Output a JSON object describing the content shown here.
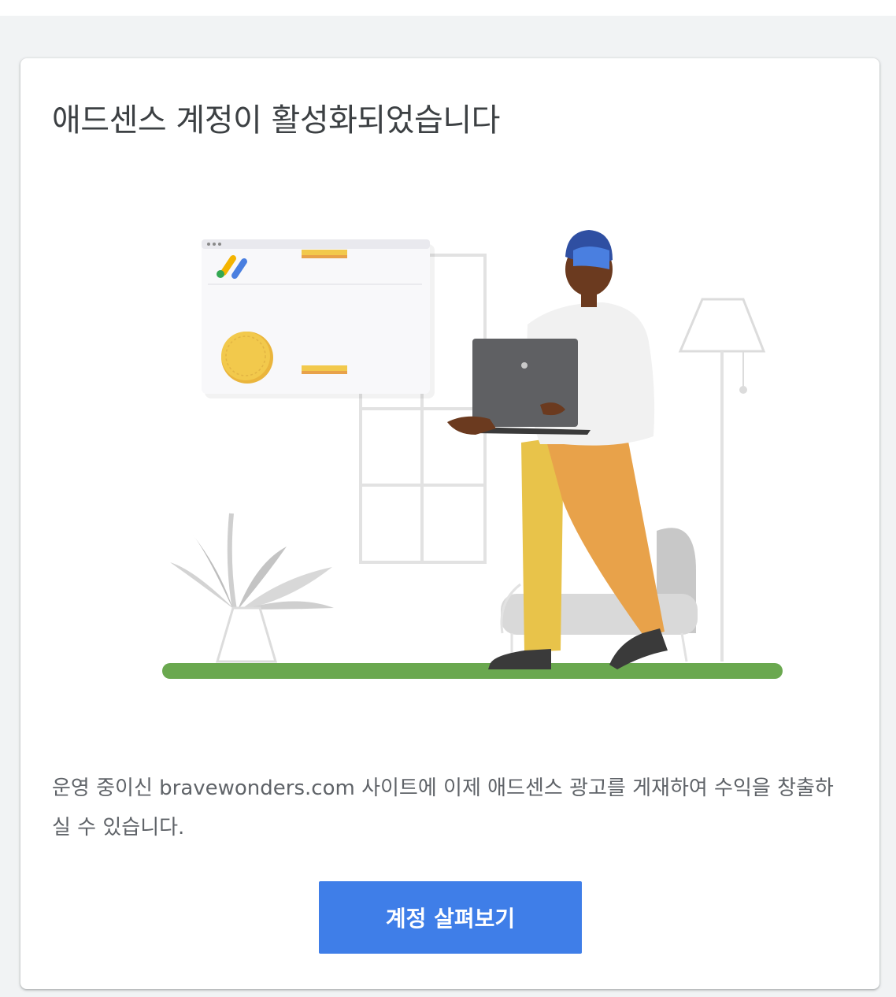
{
  "card": {
    "title": "애드센스 계정이 활성화되었습니다",
    "description": "운영 중이신 bravewonders.com 사이트에 이제 애드센스 광고를 게재하여 수익을 창출하실 수 있습니다.",
    "cta_label": "계정 살펴보기"
  },
  "colors": {
    "button": "#3f7ee8",
    "ground": "#6aa84f",
    "coin": "#f2c94c",
    "pants_yellow": "#e8c34a",
    "pants_orange": "#e8a24a",
    "hat": "#4a7fe0"
  },
  "icons": [
    "adsense-logo-icon",
    "coin-icon"
  ]
}
